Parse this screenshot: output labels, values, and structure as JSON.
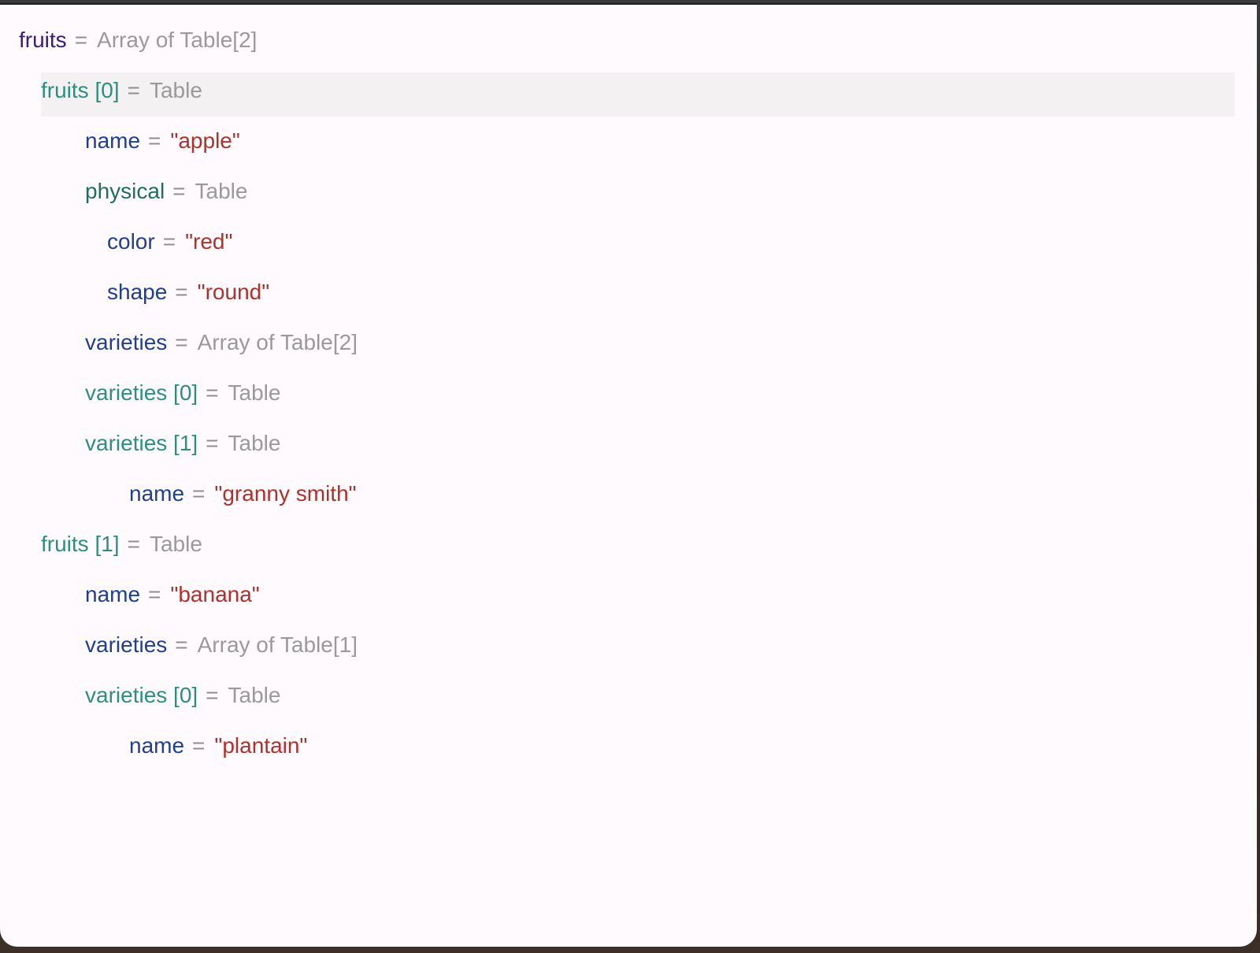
{
  "colors": {
    "root_key": "#3b1a78",
    "table_key": "#2d8f7f",
    "value_key": "#1f3f8f",
    "nested_table_key": "#1f6f5f",
    "type_text": "#9a9a9a",
    "string_value": "#b0302a",
    "selection_bg": "#f4f1f3",
    "window_bg": "#fefafd"
  },
  "tree": {
    "rows": [
      {
        "key": "fruits",
        "eq": "=",
        "value": "Array of Table[2]"
      },
      {
        "key": "fruits [0]",
        "eq": "=",
        "value": "Table"
      },
      {
        "key": "name",
        "eq": "=",
        "value": "\"apple\""
      },
      {
        "key": "physical",
        "eq": "=",
        "value": "Table"
      },
      {
        "key": "color",
        "eq": "=",
        "value": "\"red\""
      },
      {
        "key": "shape",
        "eq": "=",
        "value": "\"round\""
      },
      {
        "key": "varieties",
        "eq": "=",
        "value": "Array of Table[2]"
      },
      {
        "key": "varieties [0]",
        "eq": "=",
        "value": "Table"
      },
      {
        "key": "varieties [1]",
        "eq": "=",
        "value": "Table"
      },
      {
        "key": "name",
        "eq": "=",
        "value": "\"granny smith\""
      },
      {
        "key": "fruits [1]",
        "eq": "=",
        "value": "Table"
      },
      {
        "key": "name",
        "eq": "=",
        "value": "\"banana\""
      },
      {
        "key": "varieties",
        "eq": "=",
        "value": "Array of Table[1]"
      },
      {
        "key": "varieties [0]",
        "eq": "=",
        "value": "Table"
      },
      {
        "key": "name",
        "eq": "=",
        "value": "\"plantain\""
      }
    ]
  }
}
